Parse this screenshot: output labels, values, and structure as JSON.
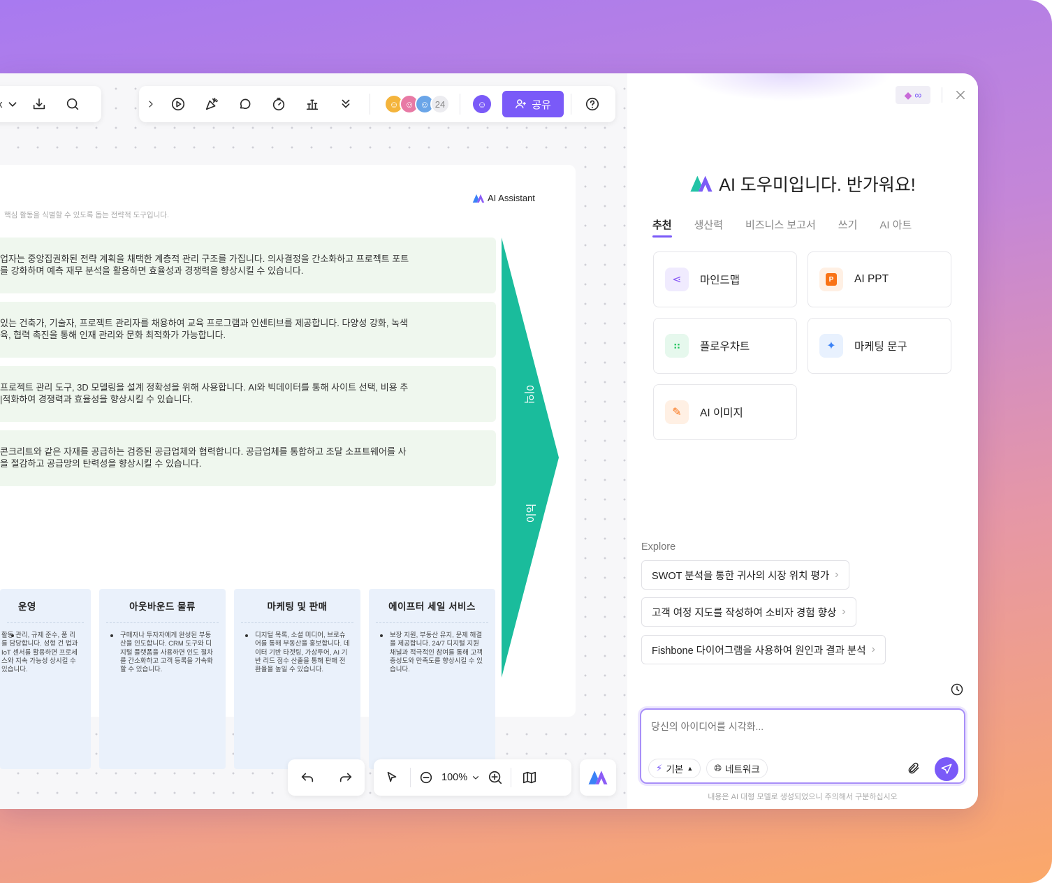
{
  "toolbar": {
    "left_partial": "x",
    "collaborator_count": "24",
    "share_label": "공유"
  },
  "document": {
    "assistant_label": "AI Assistant",
    "subtitle": "핵심 활동을 식별할 수 있도록 돕는 전략적 도구입니다.",
    "rows": [
      {
        "line1": "업자는 중앙집권화된 전략 계획을 채택한 계층적 관리 구조를 가집니다. 의사결정을 간소화하고 프로젝트 포트",
        "line2": "를 강화하며 예측 재무 분석을 활용하면 효율성과 경쟁력을 향상시킬 수 있습니다."
      },
      {
        "line1": "있는 건축가, 기술자, 프로젝트 관리자를 채용하여 교육 프로그램과 인센티브를 제공합니다. 다양성 강화, 녹색",
        "line2": "육, 협력 촉진을 통해 인재 관리와 문화 최적화가 가능합니다."
      },
      {
        "line1": "프로젝트 관리 도구, 3D 모델링을 설계 정확성을 위해 사용합니다. AI와 빅데이터를 통해 사이트 선택, 비용 추",
        "line2": "|적화하여 경쟁력과 효율성을 향상시킬 수 있습니다."
      },
      {
        "line1": "콘크리트와 같은 자재를 공급하는 검증된 공급업체와 협력합니다. 공급업체를 통합하고 조달 소프트웨어를 사",
        "line2": "을 절감하고 공급망의 탄력성을 향상시킬 수 있습니다."
      }
    ],
    "arrow_label_top": "이익",
    "arrow_label_bottom": "이익",
    "columns": [
      {
        "title": "운영",
        "text": "활동 관리, 규제 준수, 품 리를 담당합니다. 성형 건 법과 IoT 센서를 활용하면 프로세스와 지속 가능성 상시킬 수 있습니다."
      },
      {
        "title": "아웃바운드 물류",
        "text": "구매자나 투자자에게 완성된 부동산을 인도합니다. CRM 도구와 디지털 플랫폼을 사용하면 인도 절차를 간소화하고 고객 등록을 가속화할 수 있습니다."
      },
      {
        "title": "마케팅 및 판매",
        "text": "디지털 목록, 소셜 미디어, 브로슈어를 통해 부동산을 홍보합니다. 데이터 기반 타겟팅, 가상투어, AI 기반 리드 점수 산출을 통해 판매 전환율을 높일 수 있습니다."
      },
      {
        "title": "에이프터 세일 서비스",
        "text": "보장 지원, 부동산 유지, 문제 해결을 제공합니다. 24/7 디지털 지원 채널과 적극적인 참여를 통해 고객 충성도와 만족도를 향상시킬 수 있습니다."
      }
    ]
  },
  "bottom_bar": {
    "zoom": "100%"
  },
  "assistant": {
    "greeting": "AI 도우미입니다. 반가워요!",
    "tabs": [
      "추천",
      "생산력",
      "비즈니스 보고서",
      "쓰기",
      "AI 아트"
    ],
    "cards": [
      {
        "label": "마인드맵",
        "icon": "mindmap-icon",
        "color": "#8b5cf6"
      },
      {
        "label": "AI PPT",
        "icon": "ppt-icon",
        "color": "#f97316"
      },
      {
        "label": "플로우차트",
        "icon": "flowchart-icon",
        "color": "#22c55e"
      },
      {
        "label": "마케팅 문구",
        "icon": "sparkle-icon",
        "color": "#3b82f6"
      },
      {
        "label": "AI 이미지",
        "icon": "image-brush-icon",
        "color": "#f97316"
      }
    ],
    "explore_label": "Explore",
    "explore_items": [
      "SWOT 분석을 통한 귀사의 시장 위치 평가",
      "고객 여정 지도를 작성하여 소비자 경험 향상",
      "Fishbone 다이어그램을 사용하여 원인과 결과 분석"
    ],
    "input_placeholder": "당신의 아이디어를 시각화...",
    "mode_label": "기본",
    "network_label": "네트워크",
    "disclaimer": "내용은 AI 대형 모델로 생성되었으니 주의해서 구분하십시오"
  },
  "colors": {
    "accent": "#7a5af8",
    "arrow": "#1abc9c",
    "row_bg": "#eff7ee",
    "col_bg": "#eaf1fb"
  }
}
